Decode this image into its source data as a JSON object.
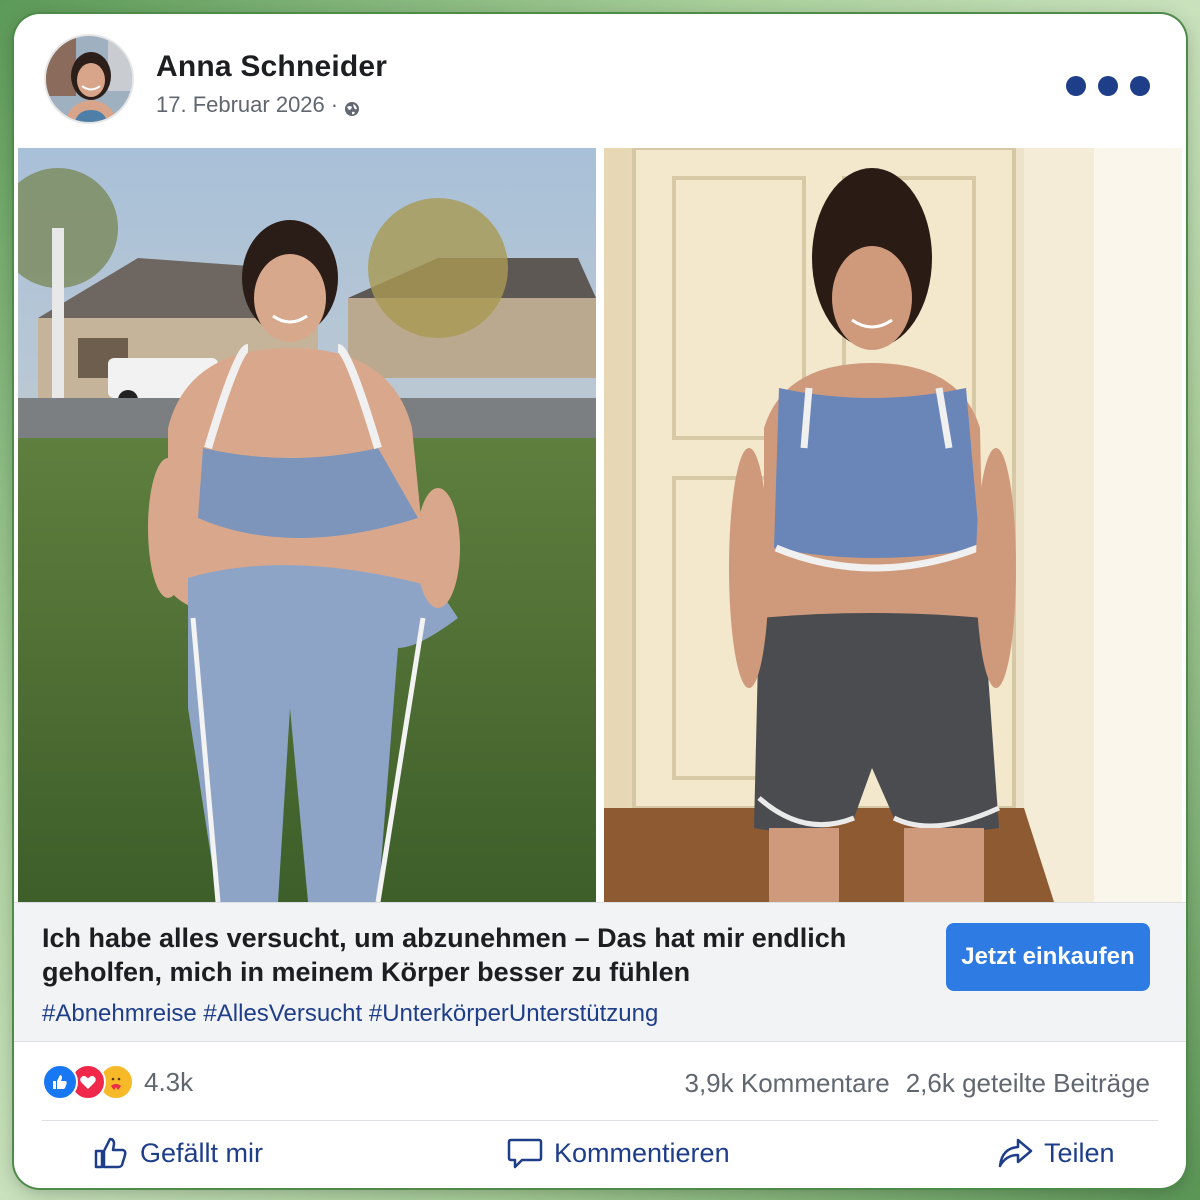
{
  "post": {
    "author": "Anna Schneider",
    "date": "17. Februar 2026",
    "separator": "·",
    "audience_icon": "globe-icon",
    "menu_icon": "more-options-icon"
  },
  "photos": {
    "before_alt": "Vorher-Foto",
    "after_alt": "Nachher-Foto"
  },
  "ad": {
    "headline": "Ich habe alles versucht, um abzunehmen – Das hat mir endlich geholfen, mich in meinem Körper besser zu fühlen",
    "hashtags": "#Abnehmreise #AllesVersucht #UnterkörperUnterstützung",
    "cta_label": "Jetzt einkaufen"
  },
  "stats": {
    "reactions_count": "4.3k",
    "comments": "3,9k Kommentare",
    "shares": "2,6k geteilte Beiträge",
    "reaction_icons": [
      "like-icon",
      "love-icon",
      "care-icon"
    ]
  },
  "actions": {
    "like": "Gefällt mir",
    "comment": "Kommentieren",
    "share": "Teilen"
  },
  "colors": {
    "accent_blue": "#1f3e8a",
    "button_blue": "#2d7be3",
    "frame_green": "#5c9a58"
  }
}
